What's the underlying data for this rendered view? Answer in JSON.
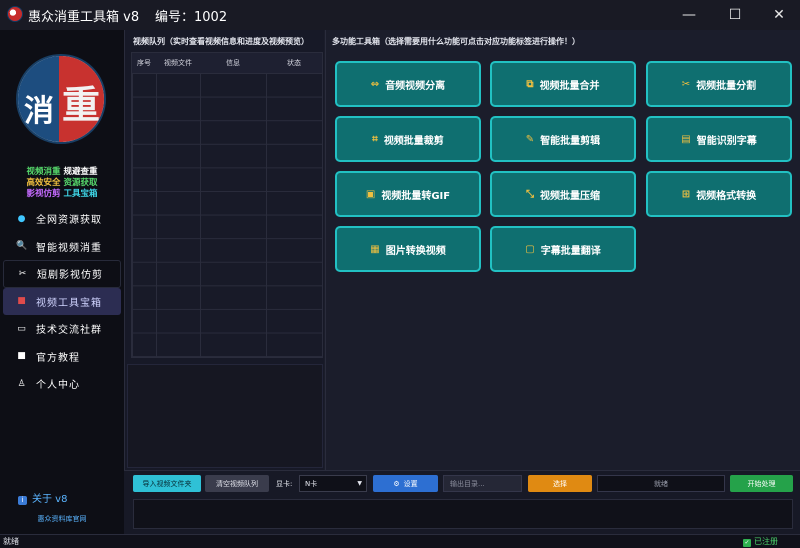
{
  "window": {
    "title": "惠众消重工具箱 v8",
    "serial": "编号：1002",
    "minimize_icon": "—",
    "maximize_icon": "☐",
    "close_icon": "✕"
  },
  "sidebar": {
    "slogans": [
      {
        "a": "视频消重",
        "b": "规避查重"
      },
      {
        "a": "高效安全",
        "b": "资源获取"
      },
      {
        "a": "影视仿剪",
        "b": "工具宝箱"
      }
    ],
    "logo_chars": {
      "left": "消",
      "right": "重"
    },
    "items": [
      {
        "label": "全网资源获取",
        "icon": "dot-icon",
        "glyph": "●"
      },
      {
        "label": "智能视频消重",
        "icon": "search-icon",
        "glyph": "🔍"
      },
      {
        "label": "短剧影视仿剪",
        "icon": "scissors-icon",
        "glyph": "✂"
      },
      {
        "label": "视频工具宝箱",
        "icon": "toolbox-icon",
        "glyph": "🧰"
      },
      {
        "label": "技术交流社群",
        "icon": "chat-icon",
        "glyph": "▭"
      },
      {
        "label": "官方教程",
        "icon": "book-icon",
        "glyph": "■"
      },
      {
        "label": "个人中心",
        "icon": "user-icon",
        "glyph": "♙"
      }
    ],
    "about": "关于 v8",
    "about_icon": "i",
    "site_link": "惠众资料库官网"
  },
  "queue": {
    "title": "视频队列（实时查看视频信息和进度及视频预览）",
    "columns": [
      "序号",
      "视频文件",
      "信息",
      "状态"
    ]
  },
  "tools": {
    "title": "多功能工具箱（选择需要用什么功能可点击对应功能标签进行操作！）",
    "buttons": [
      {
        "label": "音频视频分离",
        "icon": "split-icon",
        "glyph": "⇔"
      },
      {
        "label": "视频批量合并",
        "icon": "merge-icon",
        "glyph": "⧉"
      },
      {
        "label": "视频批量分割",
        "icon": "cut-icon",
        "glyph": "✂"
      },
      {
        "label": "视频批量裁剪",
        "icon": "crop-icon",
        "glyph": "⌗"
      },
      {
        "label": "智能批量剪辑",
        "icon": "edit-icon",
        "glyph": "✎"
      },
      {
        "label": "智能识别字幕",
        "icon": "subtitle-icon",
        "glyph": "▤"
      },
      {
        "label": "视频批量转GIF",
        "icon": "gif-icon",
        "glyph": "▣"
      },
      {
        "label": "视频批量压缩",
        "icon": "compress-icon",
        "glyph": "⤡"
      },
      {
        "label": "视频格式转换",
        "icon": "format-icon",
        "glyph": "⊞"
      },
      {
        "label": "图片转换视频",
        "icon": "image-icon",
        "glyph": "▦"
      },
      {
        "label": "字幕批量翻译",
        "icon": "translate-icon",
        "glyph": "▢"
      }
    ]
  },
  "bottom": {
    "import_label": "导入视频文件夹",
    "clear_label": "清空视频队列",
    "gpu_label": "显卡:",
    "gpu_value": "N卡",
    "settings_label": "设置",
    "settings_icon": "⚙",
    "output_placeholder": "输出目录...",
    "choose_label": "选择",
    "progress_text": "就绪",
    "start_label": "开始处理"
  },
  "status": {
    "left": "就绪",
    "right": "已注册",
    "check_icon": "✓"
  },
  "colors": {
    "accent_teal": "#0f6f70",
    "teal_border": "#22c1c3",
    "blue_button": "#2d6fd2",
    "orange_button": "#e08a12",
    "green_button": "#25a24a",
    "icon_yellow": "#f0c040"
  }
}
